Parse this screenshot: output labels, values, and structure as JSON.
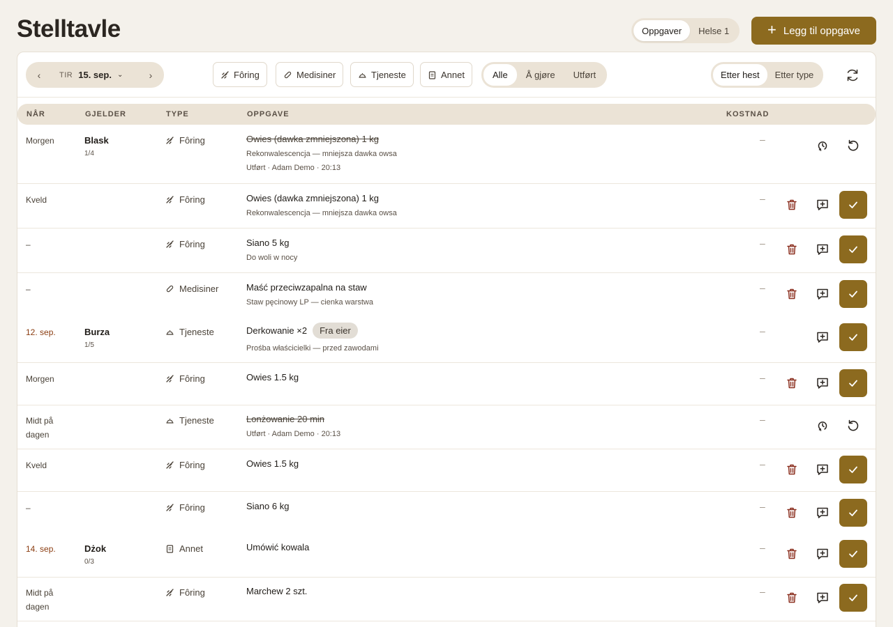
{
  "page": {
    "title": "Stelltavle"
  },
  "top_tabs": [
    {
      "label": "Oppgaver",
      "active": true
    },
    {
      "label": "Helse 1",
      "active": false
    }
  ],
  "add_button": {
    "label": "Legg til oppgave"
  },
  "date_nav": {
    "day_of_week": "TIR",
    "date": "15. sep."
  },
  "type_filters": [
    {
      "label": "Fôring",
      "icon": "feed-icon"
    },
    {
      "label": "Medisiner",
      "icon": "pill-icon"
    },
    {
      "label": "Tjeneste",
      "icon": "service-bell-icon"
    },
    {
      "label": "Annet",
      "icon": "clipboard-icon"
    }
  ],
  "status_filters": [
    {
      "label": "Alle",
      "active": true
    },
    {
      "label": "Å gjøre",
      "active": false
    },
    {
      "label": "Utført",
      "active": false
    }
  ],
  "view_toggle": [
    {
      "label": "Etter hest",
      "active": true
    },
    {
      "label": "Etter type",
      "active": false
    }
  ],
  "table": {
    "headers": {
      "when": "NÅR",
      "applies_to": "GJELDER",
      "type": "TYPE",
      "task": "OPPGAVE",
      "cost": "KOSTNAD"
    },
    "rows": [
      {
        "when": "Morgen",
        "horse": "Blask",
        "horse_count": "1/4",
        "type": "Fôring",
        "type_icon": "feed-icon",
        "task": "Owies (dawka zmniejszona) 1 kg",
        "sub": "Rekonwalescencja — mniejsza dawka owsa",
        "meta": "Utført · Adam Demo · 20:13",
        "done": true,
        "cost": "–"
      },
      {
        "when": "Kveld",
        "horse": "",
        "horse_count": "",
        "type": "Fôring",
        "type_icon": "feed-icon",
        "task": "Owies (dawka zmniejszona) 1 kg",
        "sub": "Rekonwalescencja — mniejsza dawka owsa",
        "meta": "",
        "done": false,
        "cost": "–"
      },
      {
        "when": "–",
        "horse": "",
        "horse_count": "",
        "type": "Fôring",
        "type_icon": "feed-icon",
        "task": "Siano 5 kg",
        "sub": "Do woli w nocy",
        "meta": "",
        "done": false,
        "cost": "–"
      },
      {
        "when": "–",
        "horse": "",
        "horse_count": "",
        "type": "Medisiner",
        "type_icon": "pill-icon",
        "task": "Maść przeciwzapalna na staw",
        "sub": "Staw pęcinowy LP — cienka warstwa",
        "meta": "",
        "done": false,
        "cost": "–"
      },
      {
        "when": "12. sep.",
        "horse": "Burza",
        "horse_count": "1/5",
        "type": "Tjeneste",
        "type_icon": "service-bell-icon",
        "task": "Derkowanie ×2",
        "badge": "Fra eier",
        "sub": "Prośba właścicielki — przed zawodami",
        "meta": "",
        "done": false,
        "cost": "–"
      },
      {
        "when": "Morgen",
        "horse": "",
        "horse_count": "",
        "type": "Fôring",
        "type_icon": "feed-icon",
        "task": "Owies 1.5 kg",
        "sub": "",
        "meta": "",
        "done": false,
        "cost": "–"
      },
      {
        "when": "Midt på dagen",
        "horse": "",
        "horse_count": "",
        "type": "Tjeneste",
        "type_icon": "service-bell-icon",
        "task": "Lonżowanie 20 min",
        "sub": "",
        "meta": "Utført · Adam Demo · 20:13",
        "done": true,
        "cost": "–"
      },
      {
        "when": "Kveld",
        "horse": "",
        "horse_count": "",
        "type": "Fôring",
        "type_icon": "feed-icon",
        "task": "Owies 1.5 kg",
        "sub": "",
        "meta": "",
        "done": false,
        "cost": "–"
      },
      {
        "when": "–",
        "horse": "",
        "horse_count": "",
        "type": "Fôring",
        "type_icon": "feed-icon",
        "task": "Siano 6 kg",
        "sub": "",
        "meta": "",
        "done": false,
        "cost": "–"
      },
      {
        "when": "14. sep.",
        "horse": "Dżok",
        "horse_count": "0/3",
        "type": "Annet",
        "type_icon": "clipboard-icon",
        "task": "Umówić kowala",
        "sub": "",
        "meta": "",
        "done": false,
        "cost": "–"
      },
      {
        "when": "Midt på dagen",
        "horse": "",
        "horse_count": "",
        "type": "Fôring",
        "type_icon": "feed-icon",
        "task": "Marchew 2 szt.",
        "sub": "",
        "meta": "",
        "done": false,
        "cost": "–"
      }
    ]
  },
  "colors": {
    "accent": "#8c6a1f",
    "danger": "#8a2e1e",
    "date_text": "#8a3c10",
    "background": "#f4f1eb"
  }
}
